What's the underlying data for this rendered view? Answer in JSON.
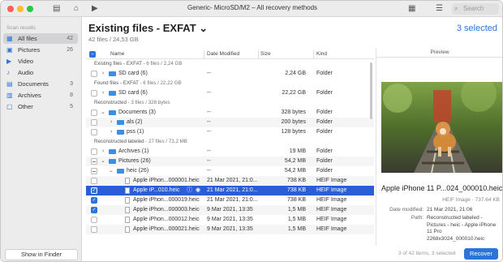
{
  "window": {
    "title": "Generic- MicroSD/M2 – All recovery methods"
  },
  "search": {
    "placeholder": "Search"
  },
  "sidebar": {
    "heading": "Scan results",
    "items": [
      {
        "label": "All files",
        "count": "42"
      },
      {
        "label": "Pictures",
        "count": "26"
      },
      {
        "label": "Video",
        "count": ""
      },
      {
        "label": "Audio",
        "count": ""
      },
      {
        "label": "Documents",
        "count": "3"
      },
      {
        "label": "Archives",
        "count": "8"
      },
      {
        "label": "Other",
        "count": "5"
      }
    ],
    "show_in_finder": "Show in Finder"
  },
  "header": {
    "title": "Existing files - EXFAT",
    "subtitle": "42 files / 24,53 GB",
    "selected": "3 selected"
  },
  "columns": {
    "name": "Name",
    "date": "Date Modified",
    "size": "Size",
    "kind": "Kind"
  },
  "rows": [
    {
      "type": "section",
      "title": "Existing files - EXFAT",
      "info": " - 6 files / 2,24 GB"
    },
    {
      "type": "item",
      "name": "SD card (6)",
      "date": "--",
      "size": "2,24 GB",
      "kind": "Folder"
    },
    {
      "type": "section",
      "title": "Found files - EXFAT",
      "info": " - 6 files / 22,22 GB"
    },
    {
      "type": "item",
      "name": "SD card (6)",
      "date": "--",
      "size": "22,22 GB",
      "kind": "Folder"
    },
    {
      "type": "section",
      "title": "Reconstructed",
      "info": " - 3 files / 328 bytes"
    },
    {
      "type": "item",
      "name": "Documents (3)",
      "date": "--",
      "size": "328 bytes",
      "kind": "Folder"
    },
    {
      "type": "item",
      "name": "als (2)",
      "date": "--",
      "size": "200 bytes",
      "kind": "Folder"
    },
    {
      "type": "item",
      "name": "pss (1)",
      "date": "--",
      "size": "128 bytes",
      "kind": "Folder"
    },
    {
      "type": "section",
      "title": "Reconstructed labeled",
      "info": " - 27 files / 73,2 MB"
    },
    {
      "type": "item",
      "name": "Archives (1)",
      "date": "--",
      "size": "19 MB",
      "kind": "Folder"
    },
    {
      "type": "item",
      "name": "Pictures (26)",
      "date": "--",
      "size": "54,2 MB",
      "kind": "Folder"
    },
    {
      "type": "item",
      "name": "heic (26)",
      "date": "--",
      "size": "54,2 MB",
      "kind": "Folder"
    },
    {
      "type": "item",
      "name": "Apple iPhon...000001.heic",
      "date": "21 Mar 2021, 21:0...",
      "size": "738 KB",
      "kind": "HEIF Image"
    },
    {
      "type": "item",
      "name": "Apple iP...010.heic",
      "date": "21 Mar 2021, 21:0...",
      "size": "738 KB",
      "kind": "HEIF Image"
    },
    {
      "type": "item",
      "name": "Apple iPhon...000019.heic",
      "date": "21 Mar 2021, 21:0...",
      "size": "738 KB",
      "kind": "HEIF Image"
    },
    {
      "type": "item",
      "name": "Apple iPhon...000003.heic",
      "date": "9 Mar 2021, 13:35",
      "size": "1,5 MB",
      "kind": "HEIF Image"
    },
    {
      "type": "item",
      "name": "Apple iPhon...000012.heic",
      "date": "9 Mar 2021, 13:35",
      "size": "1,5 MB",
      "kind": "HEIF Image"
    },
    {
      "type": "item",
      "name": "Apple iPhon...000021.heic",
      "date": "9 Mar 2021, 13:35",
      "size": "1,5 MB",
      "kind": "HEIF Image"
    }
  ],
  "preview": {
    "heading": "Preview",
    "name": "Apple iPhone 11 P...024_000010.heic",
    "kind": "HEIF Image · 737.64 KB",
    "date_label": "Date modified:",
    "date_value": "21 Mar 2021, 21:06",
    "path_label": "Path:",
    "path_value": "Reconstructed labeled - Pictures - heic - Apple iPhone 11 Pro 2268x3024_000010.heic"
  },
  "footer": {
    "count": "3 of 42 items, 3 selected",
    "recover": "Recover"
  },
  "colors": {
    "accent": "#2d74d9",
    "selection": "#2b5dd6"
  }
}
